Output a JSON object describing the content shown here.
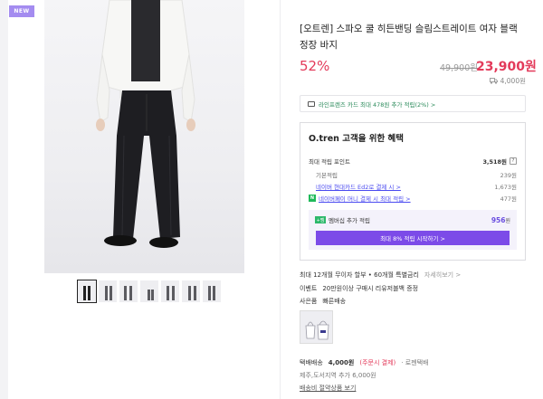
{
  "badge": "NEW",
  "product": {
    "title": "[오트렌] 스파오 쿨 히든밴딩 슬림스트레이트 여자 블랙 정장 바지",
    "discount": "52%",
    "original_price": "49,900원",
    "sale_price": "23,900원",
    "shipping_fee": "4,000원"
  },
  "card_banner": "라인프렌즈 카드 최대 478원 추가 적립(2%) >",
  "benefits": {
    "title": "O.tren 고객을 위한 혜택",
    "max_label": "최대 적립 포인트",
    "max_value": "3,518원",
    "help": "?",
    "rows": [
      {
        "label": "기본적립",
        "value": "239원"
      },
      {
        "label": "네이버 현대카드 Ed2로 결제 시 >",
        "value": "1,673원"
      },
      {
        "label": "네이버페이 머니 결제 시 최대 적립 >",
        "value": "477원"
      }
    ],
    "np_icon": "N",
    "member": {
      "icon": "+멤",
      "label": "멤버십 추가 적립",
      "value": "956",
      "unit": "원",
      "button": "최대 8% 적립 시작하기 >"
    }
  },
  "info": {
    "installment": "최대 12개월 무이자 할부 • 60개월 특별금리",
    "installment_link": "자세히보기 >",
    "event_key": "이벤트",
    "event_val": "20만원이상 구매시 리유저블백 증정",
    "gift_key": "사은품",
    "gift_val": "빠른배송"
  },
  "shipping": {
    "key": "택배배송",
    "fee": "4,000원",
    "fee_note": "(주문시 결제)",
    "carrier": "· 로젠택배",
    "extra": "제주,도서지역 추가 6,000원",
    "link": "배송비 절약상품 보기"
  }
}
